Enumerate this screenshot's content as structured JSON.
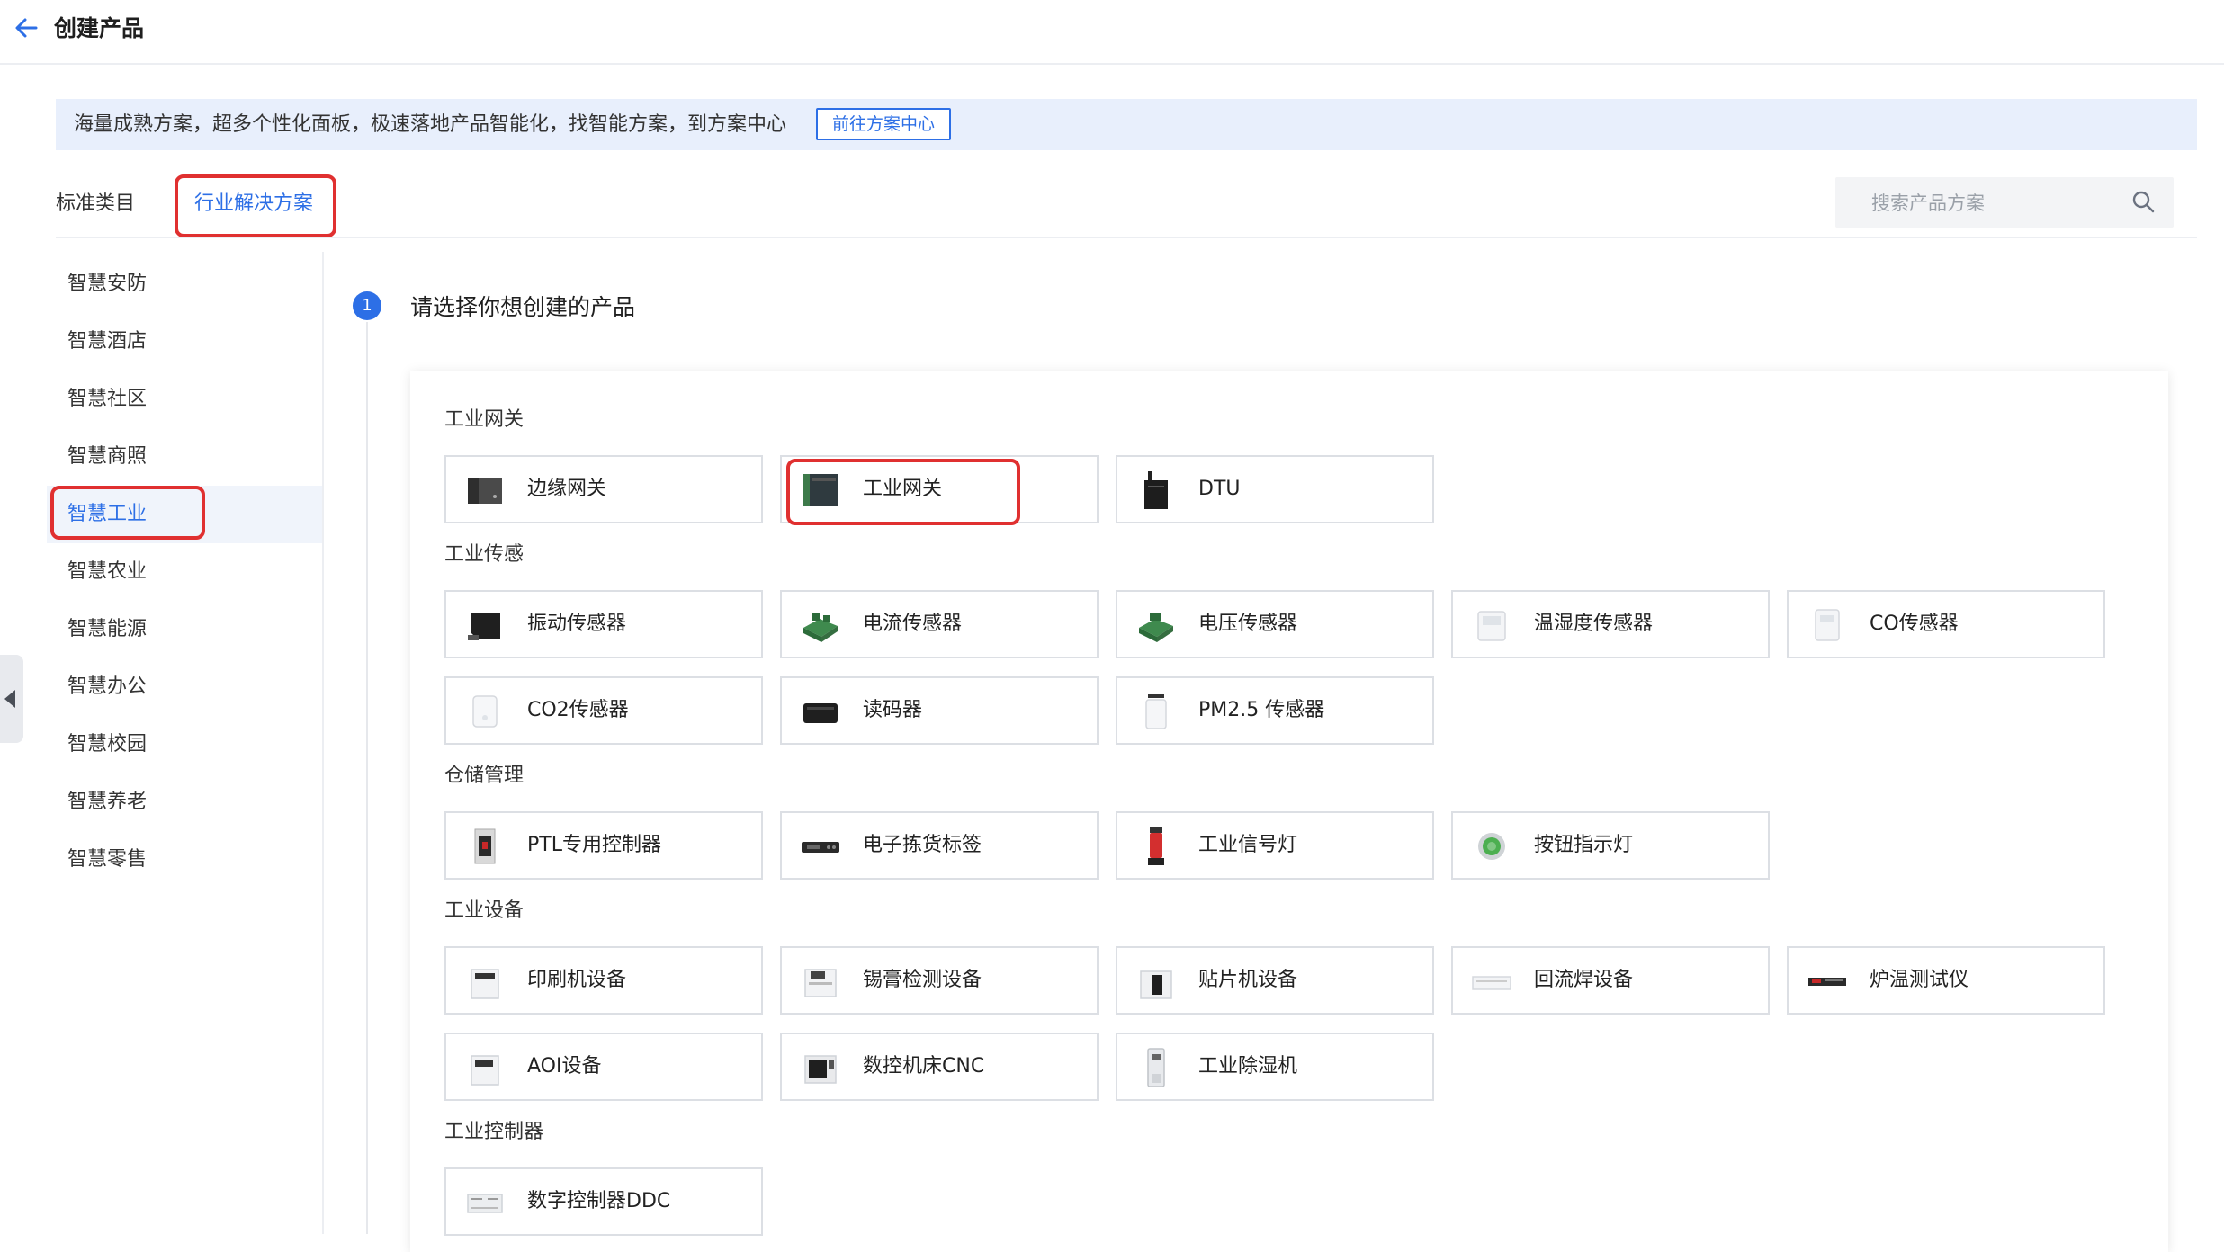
{
  "header": {
    "title": "创建产品"
  },
  "banner": {
    "text": "海量成熟方案，超多个性化面板，极速落地产品智能化，找智能方案，到方案中心",
    "button": "前往方案中心"
  },
  "tabs": [
    {
      "label": "标准类目"
    },
    {
      "label": "行业解决方案",
      "active": true
    }
  ],
  "search": {
    "placeholder": "搜索产品方案"
  },
  "sidebar": {
    "items": [
      {
        "label": "智慧安防"
      },
      {
        "label": "智慧酒店"
      },
      {
        "label": "智慧社区"
      },
      {
        "label": "智慧商照"
      },
      {
        "label": "智慧工业",
        "active": true
      },
      {
        "label": "智慧农业"
      },
      {
        "label": "智慧能源"
      },
      {
        "label": "智慧办公"
      },
      {
        "label": "智慧校园"
      },
      {
        "label": "智慧养老"
      },
      {
        "label": "智慧零售"
      }
    ]
  },
  "step": {
    "number": "1",
    "title": "请选择你想创建的产品"
  },
  "groups": [
    {
      "title": "工业网关",
      "products": [
        {
          "label": "边缘网关",
          "icon": "edge-gateway-icon"
        },
        {
          "label": "工业网关",
          "icon": "industrial-gateway-icon"
        },
        {
          "label": "DTU",
          "icon": "dtu-icon"
        }
      ]
    },
    {
      "title": "工业传感",
      "products": [
        {
          "label": "振动传感器",
          "icon": "vibration-sensor-icon"
        },
        {
          "label": "电流传感器",
          "icon": "current-sensor-icon"
        },
        {
          "label": "电压传感器",
          "icon": "voltage-sensor-icon"
        },
        {
          "label": "温湿度传感器",
          "icon": "temperature-humidity-sensor-icon"
        },
        {
          "label": "CO传感器",
          "icon": "co-sensor-icon"
        },
        {
          "label": "CO2传感器",
          "icon": "co2-sensor-icon"
        },
        {
          "label": "读码器",
          "icon": "code-reader-icon"
        },
        {
          "label": "PM2.5 传感器",
          "icon": "pm25-sensor-icon"
        }
      ]
    },
    {
      "title": "仓储管理",
      "products": [
        {
          "label": "PTL专用控制器",
          "icon": "ptl-controller-icon"
        },
        {
          "label": "电子拣货标签",
          "icon": "picking-label-icon"
        },
        {
          "label": "工业信号灯",
          "icon": "signal-light-icon"
        },
        {
          "label": "按钮指示灯",
          "icon": "button-indicator-icon"
        }
      ]
    },
    {
      "title": "工业设备",
      "products": [
        {
          "label": "印刷机设备",
          "icon": "printer-machine-icon"
        },
        {
          "label": "锡膏检测设备",
          "icon": "solder-paste-inspection-icon"
        },
        {
          "label": "贴片机设备",
          "icon": "pick-and-place-machine-icon"
        },
        {
          "label": "回流焊设备",
          "icon": "reflow-oven-icon"
        },
        {
          "label": "炉温测试仪",
          "icon": "oven-temperature-tester-icon"
        },
        {
          "label": "AOI设备",
          "icon": "aoi-device-icon"
        },
        {
          "label": "数控机床CNC",
          "icon": "cnc-machine-icon"
        },
        {
          "label": "工业除湿机",
          "icon": "dehumidifier-icon"
        }
      ]
    },
    {
      "title": "工业控制器",
      "products": [
        {
          "label": "数字控制器DDC",
          "icon": "ddc-controller-icon"
        }
      ]
    }
  ],
  "colors": {
    "accent": "#2d6fe6",
    "highlight": "#e03030",
    "banner_bg": "#e8effc"
  }
}
